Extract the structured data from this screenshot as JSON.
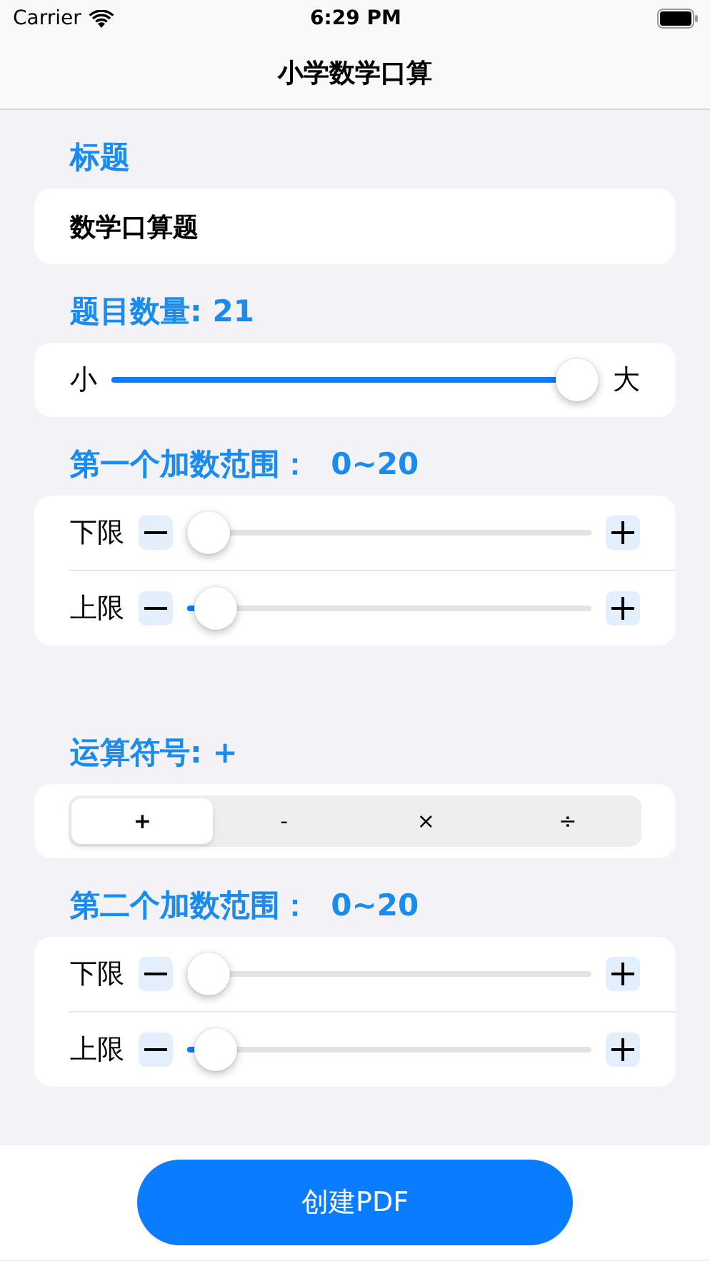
{
  "status_bar": {
    "carrier": "Carrier",
    "time": "6:29 PM"
  },
  "nav": {
    "title": "小学数学口算"
  },
  "title_section": {
    "header": "标题",
    "value": "数学口算题"
  },
  "count_section": {
    "header": "题目数量: 21",
    "min_label": "小",
    "max_label": "大",
    "level": 1.0
  },
  "first_range": {
    "header": "第一个加数范围：  0~20",
    "rows": [
      {
        "label": "下限",
        "level": 0.0
      },
      {
        "label": "上限",
        "level": 0.02
      }
    ]
  },
  "operator_section": {
    "header": "运算符号: +",
    "options": [
      {
        "label": "+",
        "selected": true
      },
      {
        "label": "-",
        "selected": false
      },
      {
        "label": "×",
        "selected": false
      },
      {
        "label": "÷",
        "selected": false
      }
    ]
  },
  "second_range": {
    "header": "第二个加数范围：  0~20",
    "rows": [
      {
        "label": "下限",
        "level": 0.0
      },
      {
        "label": "上限",
        "level": 0.02
      }
    ]
  },
  "create_button": "创建PDF"
}
